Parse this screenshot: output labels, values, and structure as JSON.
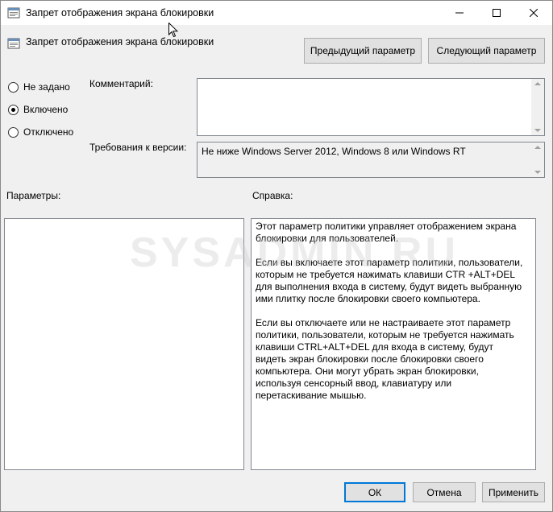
{
  "window": {
    "title": "Запрет отображения экрана блокировки"
  },
  "header": {
    "policy_title": "Запрет отображения экрана блокировки",
    "prev_button": "Предыдущий параметр",
    "next_button": "Следующий параметр"
  },
  "state": {
    "options": [
      {
        "label": "Не задано",
        "checked": false
      },
      {
        "label": "Включено",
        "checked": true
      },
      {
        "label": "Отключено",
        "checked": false
      }
    ]
  },
  "comment": {
    "label": "Комментарий:",
    "value": ""
  },
  "version": {
    "label": "Требования к версии:",
    "value": "Не ниже Windows Server 2012, Windows 8 или Windows RT"
  },
  "params": {
    "label": "Параметры:"
  },
  "help": {
    "label": "Справка:",
    "paragraphs": [
      "Этот параметр политики управляет отображением экрана блокировки для пользователей.",
      "Если вы включаете этот параметр политики, пользователи, которым не требуется нажимать клавиши CTR +ALT+DEL для выполнения входа в систему, будут видеть выбранную ими плитку после блокировки своего компьютера.",
      "Если вы отключаете или не настраиваете этот параметр политики, пользователи, которым не требуется нажимать клавиши CTRL+ALT+DEL для входа в систему, будут видеть экран блокировки после блокировки своего компьютера. Они могут убрать экран блокировки, используя сенсорный ввод, клавиатуру или перетаскивание мышью."
    ]
  },
  "footer": {
    "ok": "ОК",
    "cancel": "Отмена",
    "apply": "Применить"
  },
  "watermark": "SYSADMIN.RU",
  "colors": {
    "accent": "#0078d7",
    "window_bg": "#f0f0f0"
  }
}
